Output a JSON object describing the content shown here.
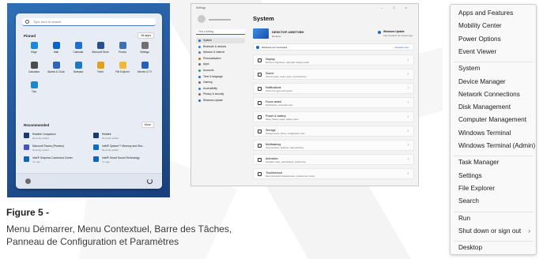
{
  "caption": {
    "figure_label": "Figure 5 -",
    "lines": [
      "Menu Démarrer, Menu Contextuel, Barre des Tâches,",
      "Panneau de Configuration et Paramètres"
    ]
  },
  "start_menu": {
    "search_placeholder": "Type here to search",
    "pinned_label": "Pinned",
    "all_apps_label": "All apps",
    "pinned_apps": [
      {
        "label": "Edge",
        "color": "#1a8ad4"
      },
      {
        "label": "Mail",
        "color": "#0a64c8"
      },
      {
        "label": "Calendar",
        "color": "#1d6fd1"
      },
      {
        "label": "Microsoft Store",
        "color": "#2a4f8f"
      },
      {
        "label": "Photos",
        "color": "#3b6fb8"
      },
      {
        "label": "Settings",
        "color": "#6f6f6f"
      },
      {
        "label": "Calculator",
        "color": "#4b4b4b"
      },
      {
        "label": "Alarms & Clock",
        "color": "#2e63b8"
      },
      {
        "label": "Notepad",
        "color": "#1b7ac8"
      },
      {
        "label": "Paint",
        "color": "#e0a21a"
      },
      {
        "label": "File Explorer",
        "color": "#f2b83a"
      },
      {
        "label": "Movies & TV",
        "color": "#2560b8"
      },
      {
        "label": "Tips",
        "color": "#1a88d0"
      }
    ],
    "recommended_label": "Recommended",
    "more_label": "More",
    "recommended": [
      {
        "title": "Realtek Companion",
        "sub": "Recently added",
        "color": "#1b3a6b"
      },
      {
        "title": "Realtek",
        "sub": "Recently added",
        "color": "#1b3a6b"
      },
      {
        "title": "Microsoft Teams (Preview)",
        "sub": "Recently added",
        "color": "#4b53bc"
      },
      {
        "title": "Intel® Optane™ Memory and Stor...",
        "sub": "Recently added",
        "color": "#0a6fc2"
      },
      {
        "title": "intel® Graphics Command Center",
        "sub": "7m ago",
        "color": "#1066b3"
      },
      {
        "title": "Intel® Smart Sound Technology",
        "sub": "7m ago",
        "color": "#1066b3"
      }
    ]
  },
  "settings": {
    "app_title": "Settings",
    "window_controls": "– □ ×",
    "find_placeholder": "Find a setting",
    "nav": [
      {
        "label": "System",
        "color": "#2666c8"
      },
      {
        "label": "Bluetooth & devices",
        "color": "#2a82d8"
      },
      {
        "label": "Network & internet",
        "color": "#5a78a0"
      },
      {
        "label": "Personalization",
        "color": "#c46a2a"
      },
      {
        "label": "Apps",
        "color": "#6a6a6a"
      },
      {
        "label": "Accounts",
        "color": "#2a9a6a"
      },
      {
        "label": "Time & language",
        "color": "#2a6ac8"
      },
      {
        "label": "Gaming",
        "color": "#6a6a6a"
      },
      {
        "label": "Accessibility",
        "color": "#2a82d8"
      },
      {
        "label": "Privacy & security",
        "color": "#6a6a6a"
      },
      {
        "label": "Windows Update",
        "color": "#2666c8"
      }
    ],
    "page_title": "System",
    "device_name": "DESKTOP-UMSTVBH",
    "device_sub": "Rename",
    "update_title": "Windows Update",
    "update_sub": "Last checked: 41 minutes ago",
    "banner_text": "Windows isn't activated.",
    "banner_action": "Activate now",
    "rows": [
      {
        "title": "Display",
        "sub": "Monitors, brightness, night light, display profile"
      },
      {
        "title": "Sound",
        "sub": "Volume levels, output, input, sound devices"
      },
      {
        "title": "Notifications",
        "sub": "Alerts from apps and system"
      },
      {
        "title": "Focus assist",
        "sub": "Notifications, automatic rules"
      },
      {
        "title": "Power & battery",
        "sub": "Sleep, battery usage, battery saver"
      },
      {
        "title": "Storage",
        "sub": "Storage space, drives, configuration rules"
      },
      {
        "title": "Multitasking",
        "sub": "Snap windows, desktops, task switching"
      },
      {
        "title": "Activation",
        "sub": "Activation state, subscriptions, product key"
      },
      {
        "title": "Troubleshoot",
        "sub": "Recommended troubleshooters, preferences, history"
      }
    ]
  },
  "context_menu": {
    "items": [
      "Apps and Features",
      "Mobility Center",
      "Power Options",
      "Event Viewer",
      "System",
      "Device Manager",
      "Network Connections",
      "Disk Management",
      "Computer Management",
      "Windows Terminal",
      "Windows Terminal (Admin)",
      "Task Manager",
      "Settings",
      "File Explorer",
      "Search",
      "Run",
      "Shut down or sign out",
      "Desktop"
    ],
    "submenu_arrow": "›"
  }
}
